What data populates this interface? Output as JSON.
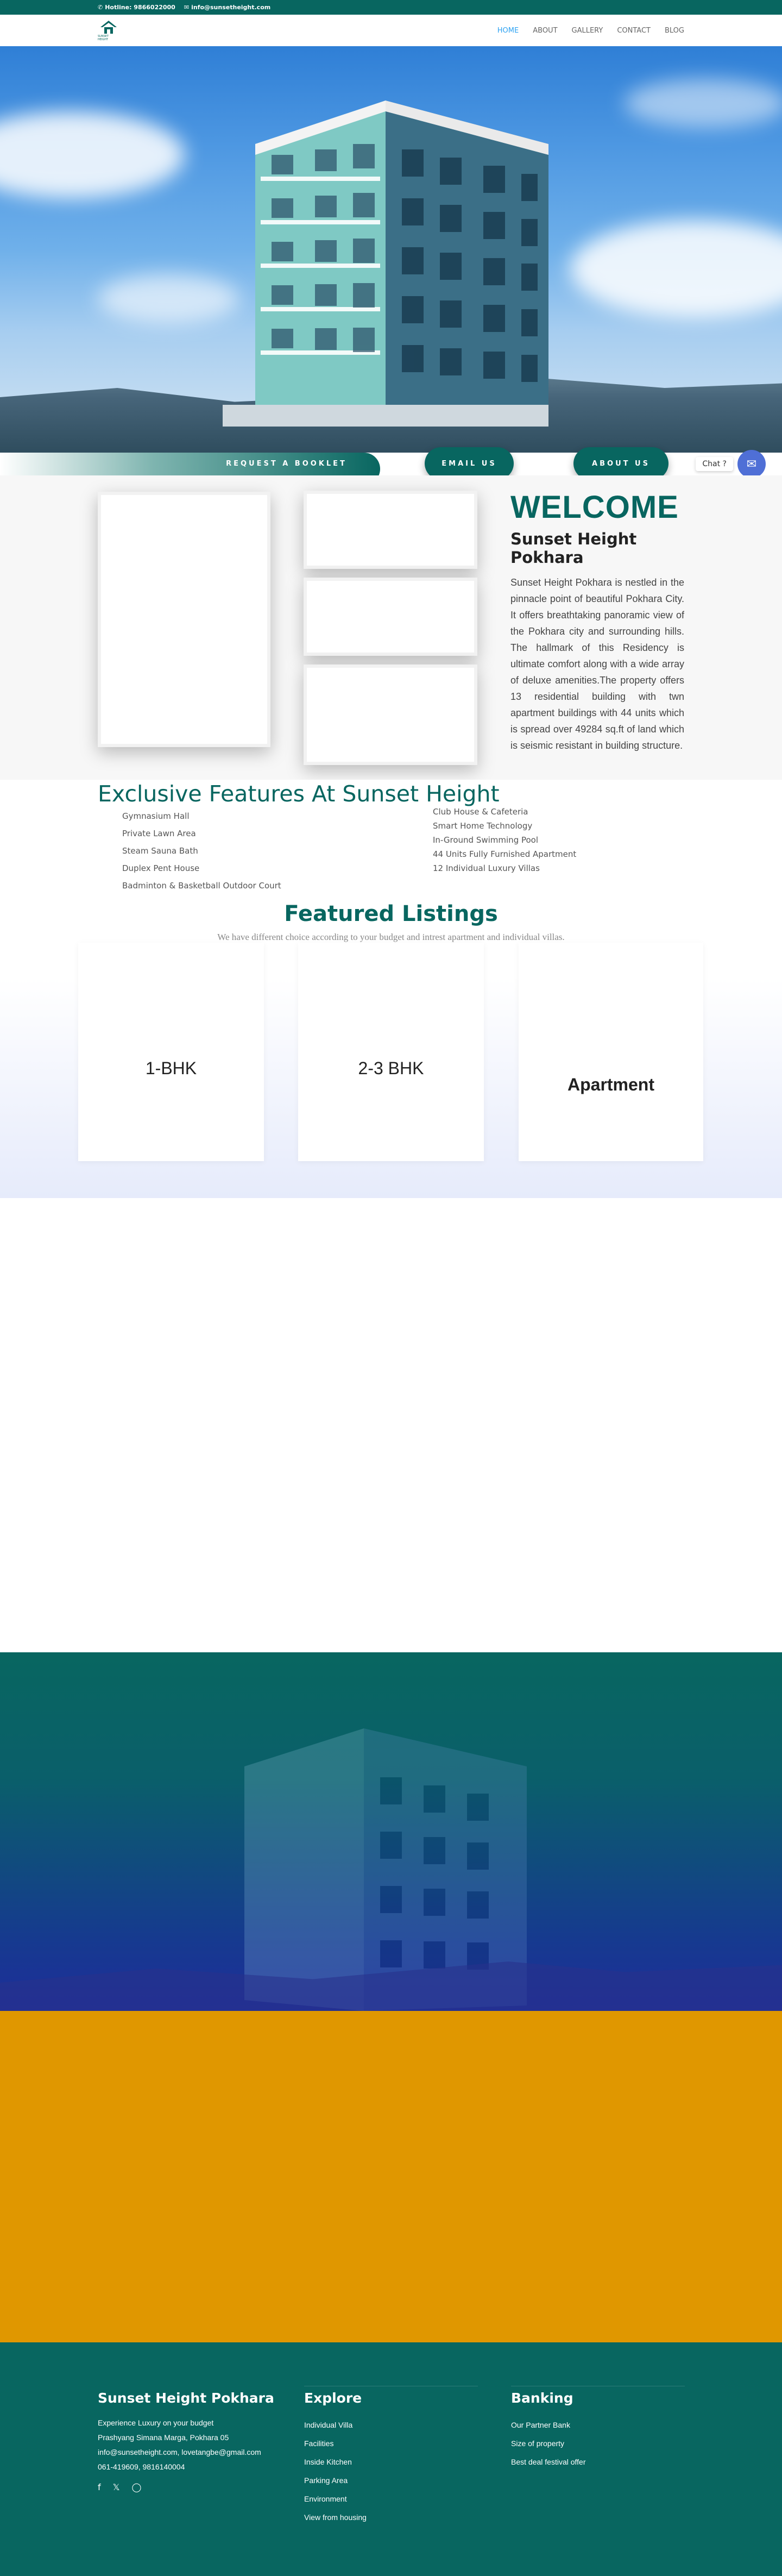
{
  "topbar": {
    "hotline": "Hotline: 9866022000",
    "email": "info@sunsetheight.com"
  },
  "header": {
    "logo_text": "SUNSET HEIGHT",
    "nav": [
      "HOME",
      "ABOUT",
      "GALLERY",
      "CONTACT",
      "BLOG"
    ],
    "active_index": 0,
    "active_color": "#2ea3f2"
  },
  "hero_buttons": {
    "booklet": "REQUEST A BOOKLET",
    "email": "EMAIL US",
    "about": "ABOUT US"
  },
  "chat": {
    "label": "Chat ?",
    "icon": "chat-icon"
  },
  "welcome": {
    "title": "WELCOME",
    "subtitle": "Sunset Height Pokhara",
    "body": "Sunset Height Pokhara is nestled in the pinnacle point of beautiful Pokhara City. It offers breathtaking panoramic view of the Pokhara city and surrounding hills. The hallmark of this Residency is ultimate comfort along with a wide array of deluxe amenities.The property offers 13 residential building with twn apartment buildings with 44 units which is spread over 49284 sq.ft of land which is seismic resistant in building structure."
  },
  "features": {
    "title": "Exclusive Features At Sunset Height",
    "left": [
      "Gymnasium Hall",
      "Private Lawn Area",
      "Steam Sauna Bath",
      "Duplex Pent House",
      "Badminton & Basketball Outdoor Court"
    ],
    "right": [
      "Club House & Cafeteria",
      "Smart Home Technology",
      "In-Ground Swimming Pool",
      "44 Units Fully Furnished Apartment",
      "12 Individual Luxury Villas"
    ]
  },
  "featured": {
    "title": "Featured Listings",
    "subtitle": "We have different choice according to your budget and intrest apartment and individual villas.",
    "cards": [
      "1-BHK",
      "2-3 BHK",
      "Apartment"
    ]
  },
  "footer": {
    "col1": {
      "title": "Sunset Height Pokhara",
      "lines": [
        "Experience Luxury on your budget",
        "Prashyang Simana Marga, Pokhara 05",
        "info@sunsetheight.com, lovetangbe@gmail.com",
        "061-419609, 9816140004"
      ],
      "social": [
        "facebook-icon",
        "x-icon",
        "instagram-icon"
      ]
    },
    "col2": {
      "title": "Explore",
      "links": [
        "Individual Villa",
        "Facilities",
        "Inside Kitchen",
        "Parking Area",
        "Environment",
        "View from housing"
      ]
    },
    "col3": {
      "title": "Banking",
      "links": [
        "Our Partner Bank",
        "Size of property",
        "Best deal festival offer"
      ]
    }
  },
  "colors": {
    "brand_teal": "#086660",
    "orange": "#e09700",
    "chat_blue": "#4f6fd6"
  }
}
